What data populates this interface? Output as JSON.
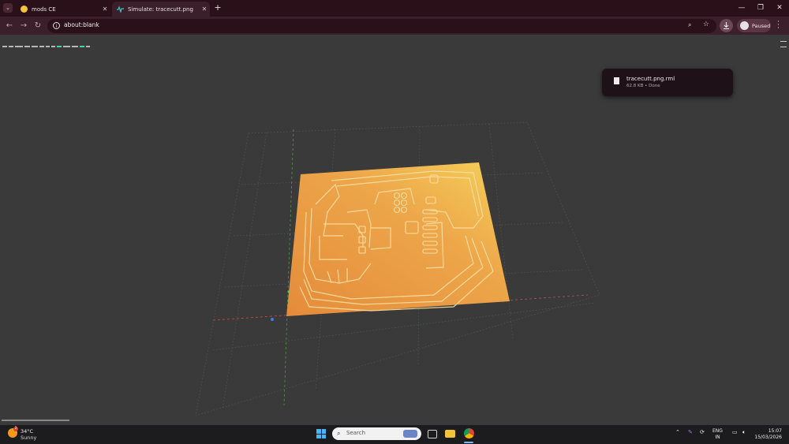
{
  "browser": {
    "tabs": [
      {
        "title": "mods CE",
        "active": false
      },
      {
        "title": "Simulate: tracecutt.png",
        "active": true
      }
    ],
    "new_tab_label": "+",
    "url": "about:blank",
    "profile_label": "Paused",
    "window_controls": {
      "minimize": "—",
      "restore": "❐",
      "close": "✕"
    },
    "accent": "#3b1f2b"
  },
  "download": {
    "filename": "tracecutt.png.rml",
    "meta": "62.8 KB • Done"
  },
  "scene": {
    "board_color_start": "#e48b3a",
    "board_color_end": "#f5d15a",
    "grid_color": "#5a6b5a"
  },
  "taskbar": {
    "weather": {
      "temp": "34°C",
      "condition": "Sunny",
      "badge": "2"
    },
    "search_placeholder": "Search",
    "language": {
      "line1": "ENG",
      "line2": "IN"
    },
    "clock": {
      "time": "15:07",
      "date": "15/03/2026"
    }
  }
}
